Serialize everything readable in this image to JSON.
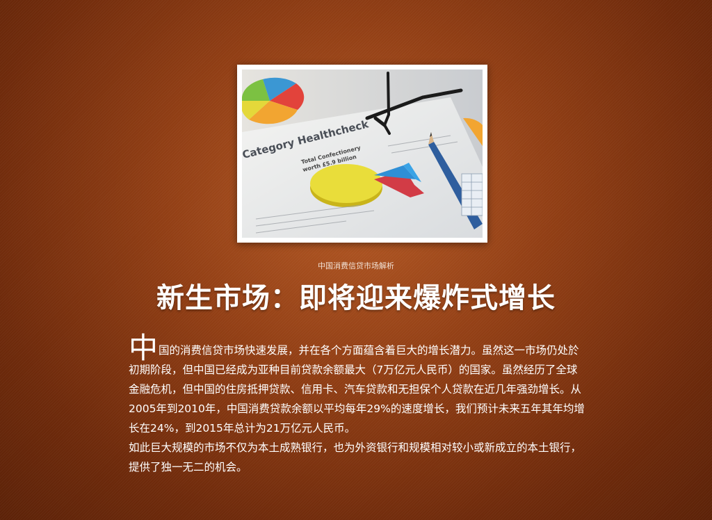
{
  "hero_image": {
    "chart_heading": "Category Healthcheck",
    "chart_callout_line1": "Total Confectionery",
    "chart_callout_line2": "worth £5.9 billion"
  },
  "header": {
    "subtitle": "中国消费信贷市场解析",
    "title": "新生市场：即将迎来爆炸式增长"
  },
  "article": {
    "dropcap": "中",
    "para1_rest": "国的消费信贷市场快速发展，并在各个方面蕴含着巨大的增长潜力。虽然这一市场仍处於初期阶段，但中国已经成为亚种目前贷款余额最大（7万亿元人民币）的国家。虽然经历了全球金融危机，但中国的住房抵押贷款、信用卡、汽车贷款和无担保个人贷款在近几年强劲增长。从2005年到2010年，中国消费贷款余额以平均每年29%的速度增长，我们预计未来五年其年均增长在24%，到2015年总计为21万亿元人民币。",
    "para2": "如此巨大规模的市场不仅为本土成熟银行，也为外资银行和规模相对较小或新成立的本土银行，提供了独一无二的机会。"
  }
}
